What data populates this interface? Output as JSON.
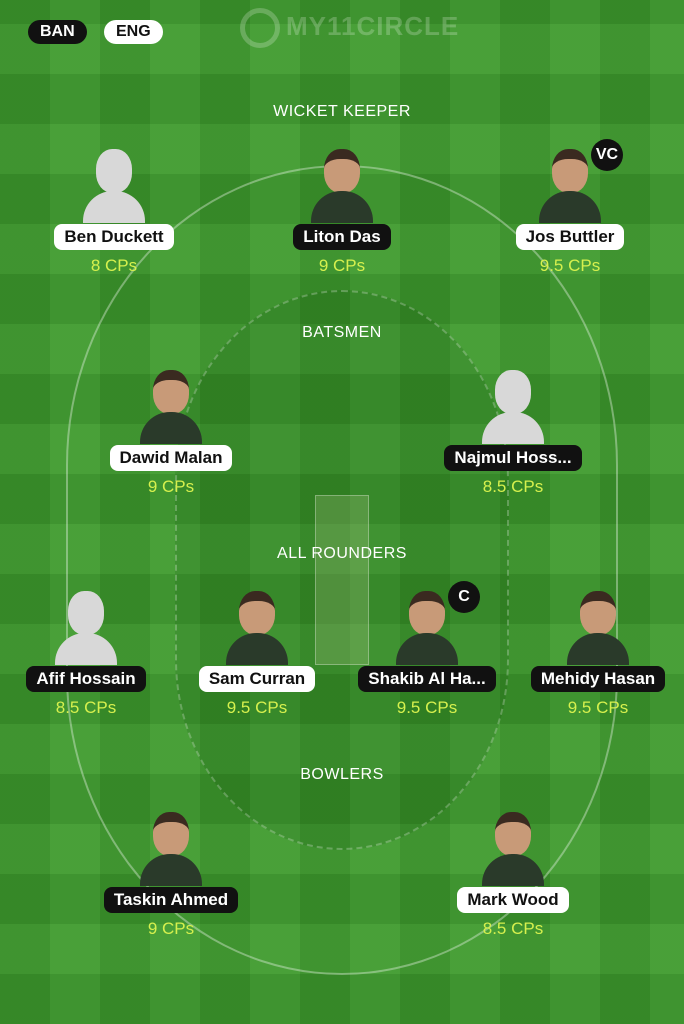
{
  "teams": [
    {
      "label": "BAN",
      "style": "black"
    },
    {
      "label": "ENG",
      "style": "white"
    }
  ],
  "logo": "MY11CIRCLE",
  "colors": {
    "field": "#3d9a2c",
    "cp_text": "#d6f04e"
  },
  "sections": [
    {
      "label": "WICKET KEEPER",
      "players": [
        {
          "name": "Ben Duckett",
          "cps": "8 CPs",
          "pill": "white",
          "photo": false
        },
        {
          "name": "Liton Das",
          "cps": "9 CPs",
          "pill": "black",
          "photo": true
        },
        {
          "name": "Jos Buttler",
          "cps": "9.5 CPs",
          "pill": "white",
          "photo": true,
          "badge": "VC"
        }
      ]
    },
    {
      "label": "BATSMEN",
      "players": [
        {
          "name": "Dawid Malan",
          "cps": "9 CPs",
          "pill": "white",
          "photo": true
        },
        {
          "name": "Najmul Hoss...",
          "cps": "8.5 CPs",
          "pill": "black",
          "photo": false
        }
      ]
    },
    {
      "label": "ALL ROUNDERS",
      "players": [
        {
          "name": "Afif Hossain",
          "cps": "8.5 CPs",
          "pill": "black",
          "photo": false
        },
        {
          "name": "Sam Curran",
          "cps": "9.5 CPs",
          "pill": "white",
          "photo": true
        },
        {
          "name": "Shakib Al Ha...",
          "cps": "9.5 CPs",
          "pill": "black",
          "photo": true,
          "badge": "C"
        },
        {
          "name": "Mehidy Hasan",
          "cps": "9.5 CPs",
          "pill": "black",
          "photo": true
        }
      ]
    },
    {
      "label": "BOWLERS",
      "players": [
        {
          "name": "Taskin Ahmed",
          "cps": "9 CPs",
          "pill": "black",
          "photo": true
        },
        {
          "name": "Mark Wood",
          "cps": "8.5 CPs",
          "pill": "white",
          "photo": true
        }
      ]
    }
  ]
}
